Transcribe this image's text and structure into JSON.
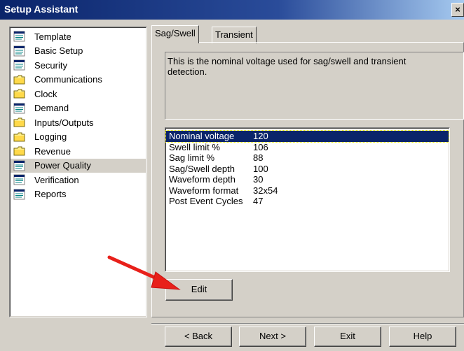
{
  "window": {
    "title": "Setup Assistant",
    "close_glyph": "×"
  },
  "tree": {
    "items": [
      {
        "label": "Template",
        "icon": "document-icon"
      },
      {
        "label": "Basic Setup",
        "icon": "document-icon"
      },
      {
        "label": "Security",
        "icon": "document-icon"
      },
      {
        "label": "Communications",
        "icon": "folder-icon"
      },
      {
        "label": "Clock",
        "icon": "folder-icon"
      },
      {
        "label": "Demand",
        "icon": "document-icon"
      },
      {
        "label": "Inputs/Outputs",
        "icon": "folder-icon"
      },
      {
        "label": "Logging",
        "icon": "folder-icon"
      },
      {
        "label": "Revenue",
        "icon": "folder-icon"
      },
      {
        "label": "Power Quality",
        "icon": "document-icon",
        "selected": true
      },
      {
        "label": "Verification",
        "icon": "document-icon"
      },
      {
        "label": "Reports",
        "icon": "document-icon"
      }
    ]
  },
  "tabs": [
    {
      "label": "Sag/Swell",
      "active": true
    },
    {
      "label": "Transient",
      "active": false
    }
  ],
  "description": "This is the nominal voltage used for sag/swell and transient\ndetection.",
  "parameters": [
    {
      "name": "Nominal voltage",
      "value": "120",
      "selected": true
    },
    {
      "name": "Swell limit %",
      "value": "106"
    },
    {
      "name": "Sag limit %",
      "value": "88"
    },
    {
      "name": "Sag/Swell depth",
      "value": "100"
    },
    {
      "name": "Waveform depth",
      "value": "30"
    },
    {
      "name": "Waveform format",
      "value": "32x54"
    },
    {
      "name": "Post Event Cycles",
      "value": "47"
    }
  ],
  "buttons": {
    "edit": "Edit",
    "back": "< Back",
    "next": "Next >",
    "exit": "Exit",
    "help": "Help"
  },
  "colors": {
    "title_bar": "#0a246a",
    "selection": "#0a246a",
    "annotation_arrow": "#e8201a",
    "dialog_face": "#d4d0c8"
  }
}
